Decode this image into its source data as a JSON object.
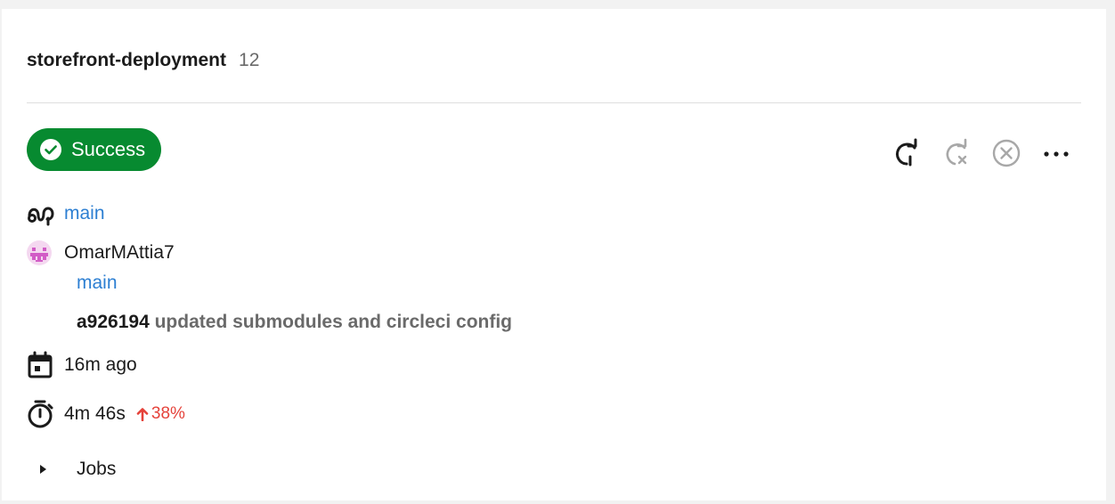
{
  "pipeline": {
    "project_name": "storefront-deployment",
    "build_number": "12"
  },
  "status": {
    "label": "Success",
    "color": "#078a30"
  },
  "actions": [
    {
      "name": "rerun-icon",
      "enabled": true
    },
    {
      "name": "rerun-failed-icon",
      "enabled": false
    },
    {
      "name": "cancel-icon",
      "enabled": false
    },
    {
      "name": "more-icon",
      "enabled": true
    }
  ],
  "branch": {
    "name": "main"
  },
  "trigger": {
    "user": "OmarMAttia7",
    "branch": "main",
    "commit_hash": "a926194",
    "commit_message": "updated submodules and circleci config"
  },
  "time": {
    "started": "16m ago",
    "duration": "4m 46s",
    "delta": "38%",
    "delta_color": "#e5423a"
  },
  "jobs": {
    "label": "Jobs"
  }
}
